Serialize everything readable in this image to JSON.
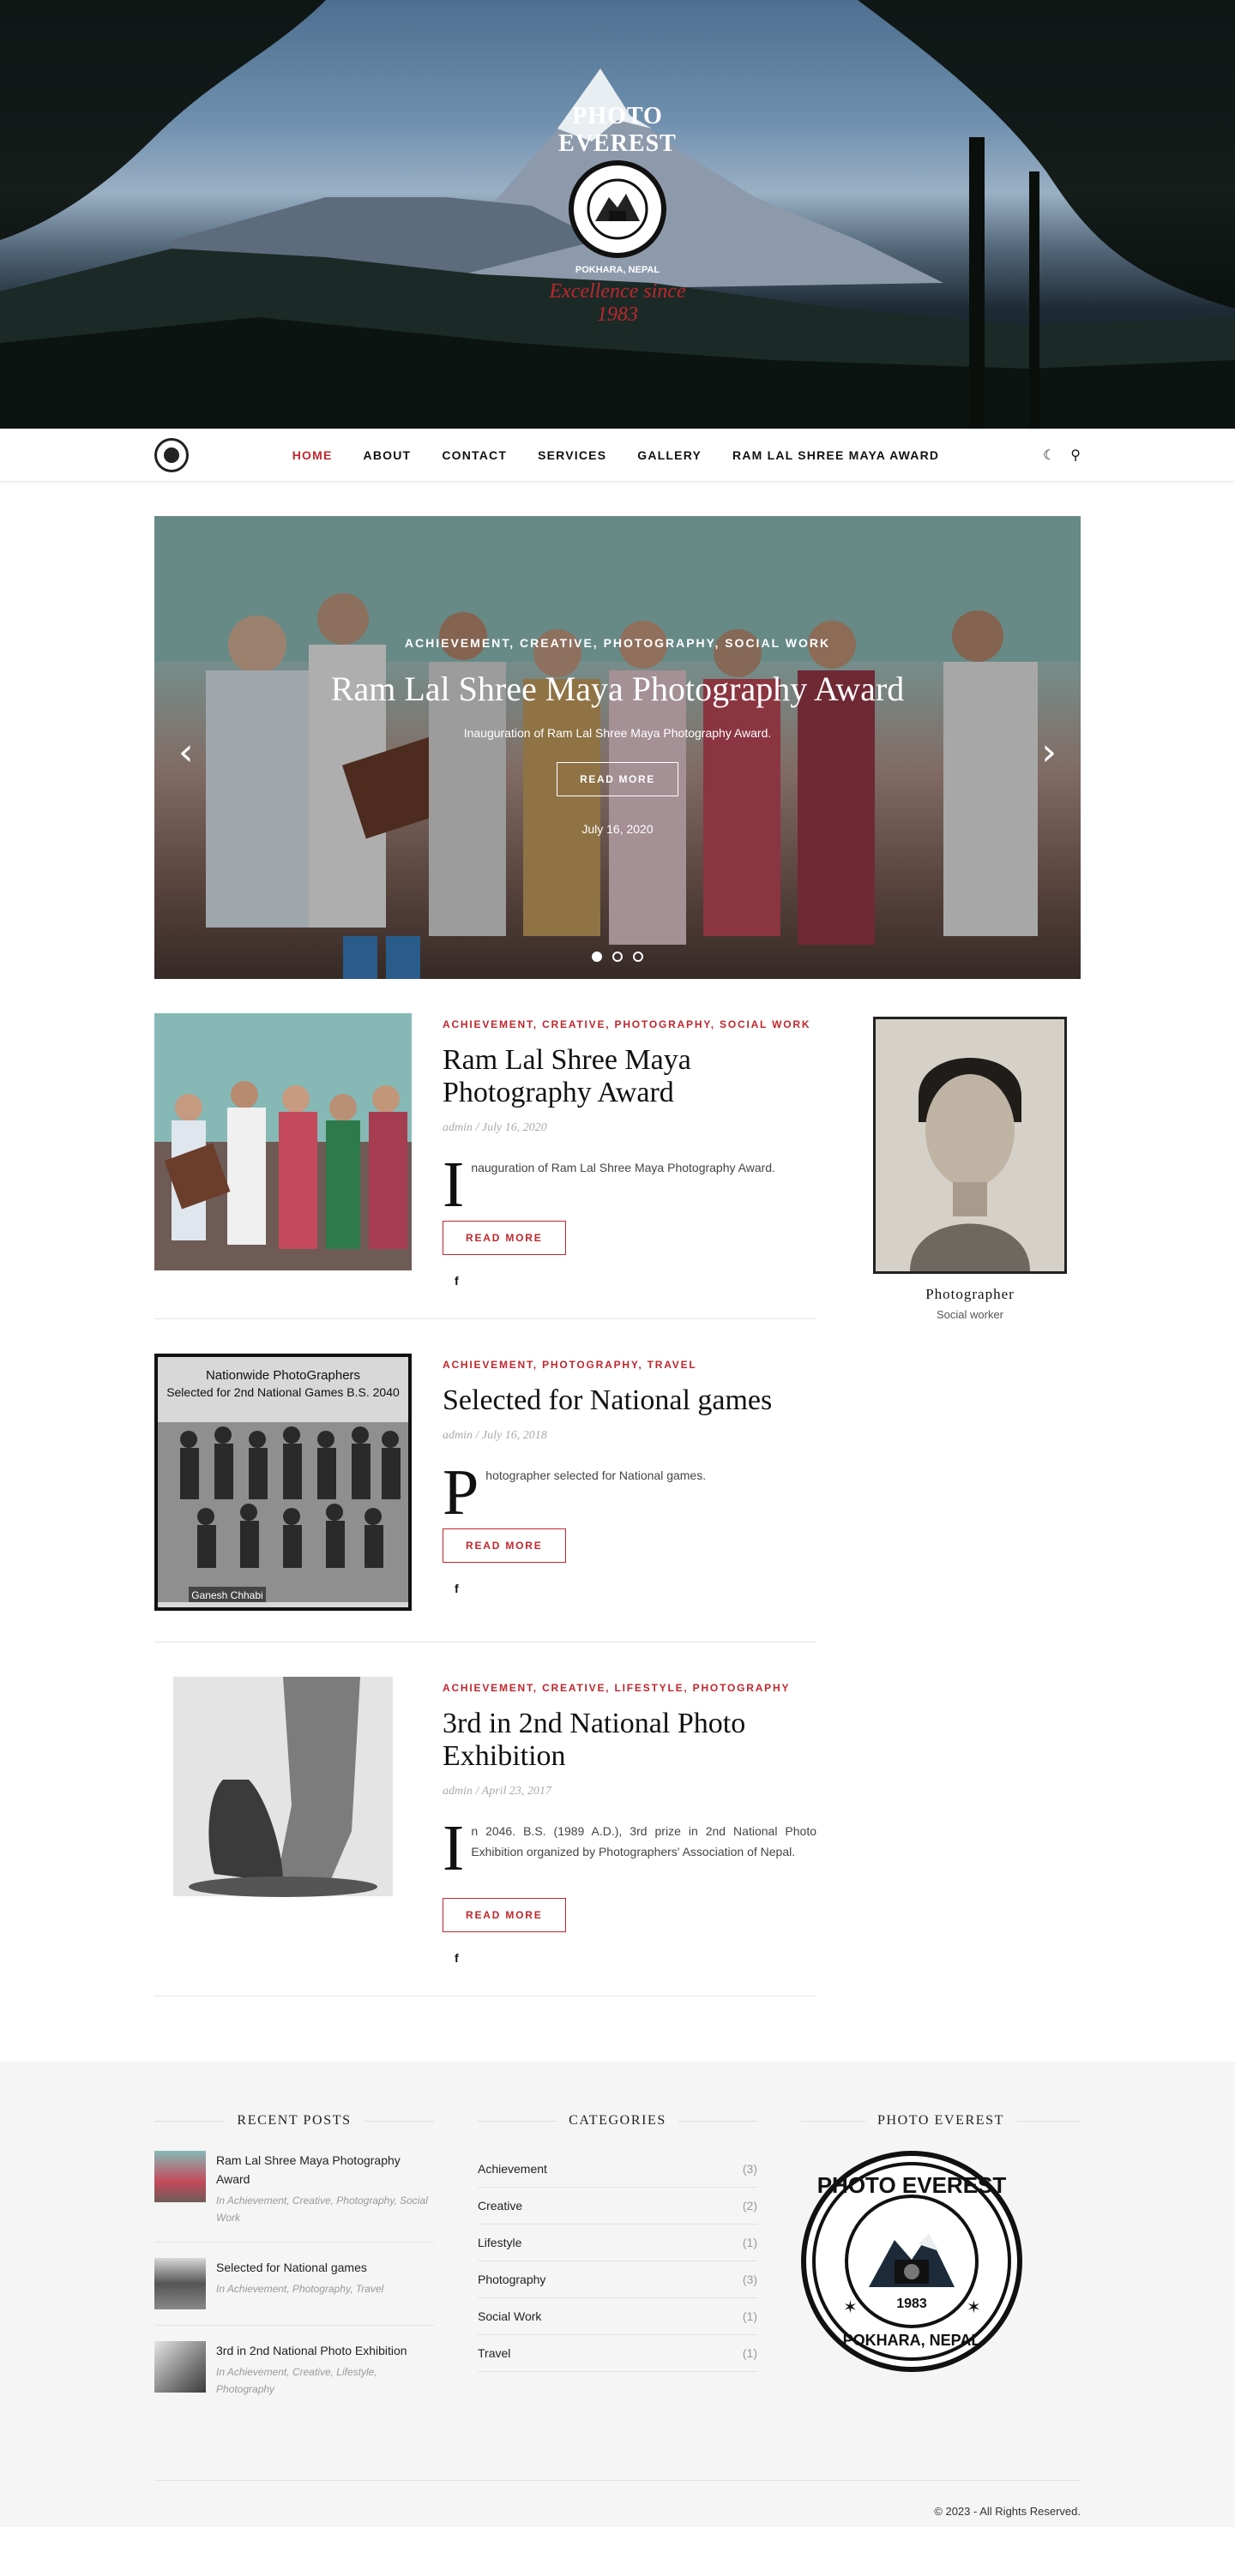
{
  "hero": {
    "logo_text": "PHOTO EVEREST",
    "logo_sub": "POKHARA, NEPAL",
    "logo_year": "1983",
    "tagline": "Excellence since 1983"
  },
  "nav": {
    "items": [
      {
        "label": "Home",
        "active": true
      },
      {
        "label": "About",
        "active": false
      },
      {
        "label": "Contact",
        "active": false
      },
      {
        "label": "Services",
        "active": false
      },
      {
        "label": "Gallery",
        "active": false
      },
      {
        "label": "Ram Lal Shree Maya Award",
        "active": false
      }
    ],
    "icons": [
      "moon-icon",
      "search-icon"
    ]
  },
  "slider": {
    "categories": "Achievement, Creative, Photography, Social Work",
    "title": "Ram Lal Shree Maya Photography Award",
    "excerpt": "Inauguration of Ram Lal Shree Maya Photography Award.",
    "button": "Read More",
    "date": "July 16, 2020",
    "dots": 3,
    "active_dot": 0
  },
  "posts": [
    {
      "categories": "Achievement, Creative, Photography, Social Work",
      "title": "Ram Lal Shree Maya Photography Award",
      "meta": "admin / July 16, 2020",
      "dropcap": "I",
      "excerpt": "nauguration of Ram Lal Shree Maya Photography Award.",
      "button": "Read More"
    },
    {
      "categories": "Achievement, Photography, Travel",
      "title": "Selected for National games",
      "meta": "admin / July 16, 2018",
      "dropcap": "P",
      "excerpt": "hotographer selected for National games.",
      "button": "Read More",
      "image_caption_1": "Nationwide PhotoGraphers",
      "image_caption_2": "Selected for 2nd National Games B.S. 2040",
      "image_credit": "Ganesh Chhabi"
    },
    {
      "categories": "Achievement, Creative, Lifestyle, Photography",
      "title": "3rd in 2nd National Photo Exhibition",
      "meta": "admin / April 23, 2017",
      "dropcap": "I",
      "excerpt": "n 2046. B.S. (1989 A.D.), 3rd prize in 2nd National Photo Exhibition organized by Photographers' Association of Nepal.",
      "button": "Read More"
    }
  ],
  "sidebar": {
    "name": "Photographer",
    "role": "Social worker"
  },
  "footer": {
    "recent_title": "Recent Posts",
    "recent": [
      {
        "title": "Ram Lal Shree Maya Photography Award",
        "cats": "In Achievement, Creative, Photography, Social Work"
      },
      {
        "title": "Selected for National games",
        "cats": "In Achievement, Photography, Travel"
      },
      {
        "title": "3rd in 2nd National Photo Exhibition",
        "cats": "In Achievement, Creative, Lifestyle, Photography"
      }
    ],
    "categories_title": "Categories",
    "categories": [
      {
        "name": "Achievement",
        "count": "(3)"
      },
      {
        "name": "Creative",
        "count": "(2)"
      },
      {
        "name": "Lifestyle",
        "count": "(1)"
      },
      {
        "name": "Photography",
        "count": "(3)"
      },
      {
        "name": "Social Work",
        "count": "(1)"
      },
      {
        "name": "Travel",
        "count": "(1)"
      }
    ],
    "brand_title": "Photo Everest",
    "brand_logo_text": "PHOTO EVEREST",
    "brand_logo_year": "1983",
    "brand_logo_sub": "POKHARA, NEPAL",
    "copyright": "© 2023 - All Rights Reserved."
  },
  "colors": {
    "accent": "#c0262d",
    "text": "#222222",
    "footer_bg": "#f5f5f5"
  }
}
